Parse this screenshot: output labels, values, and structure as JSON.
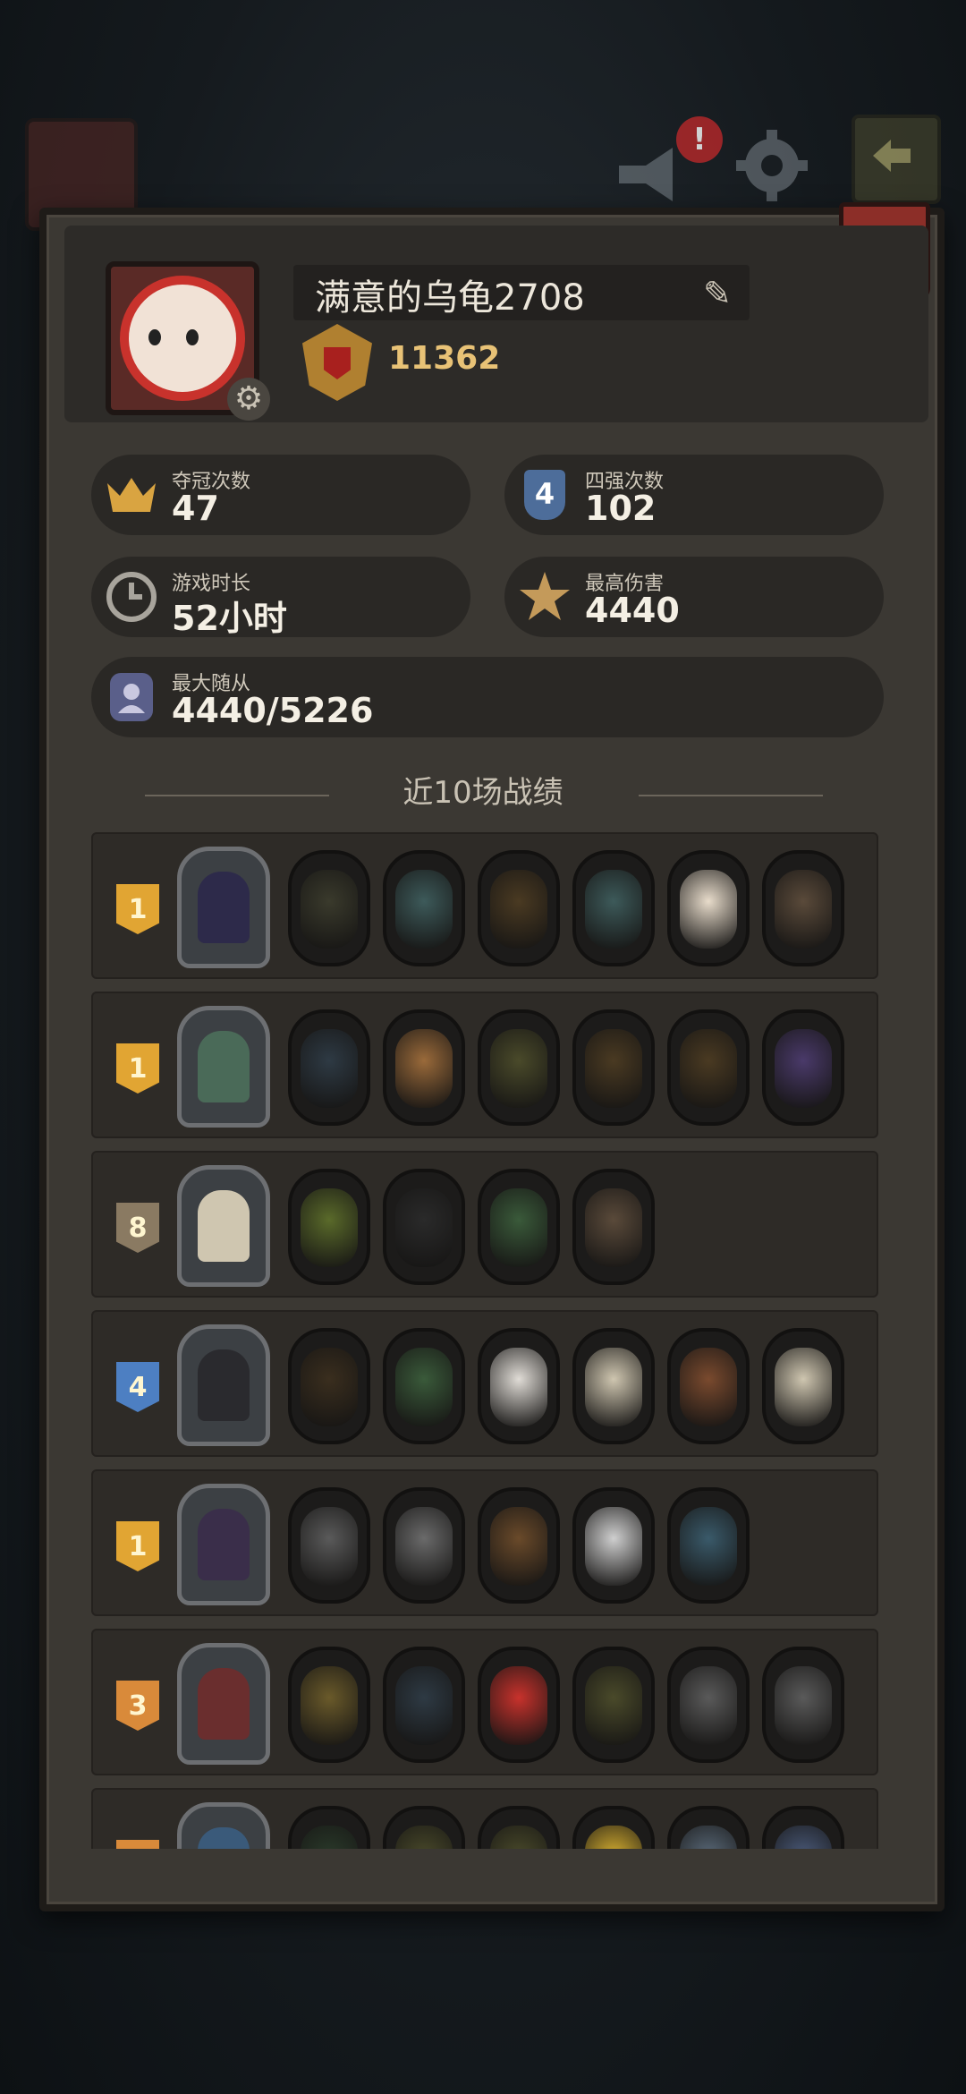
{
  "colors": {
    "gold": "#e8c276",
    "panel": "#3b3833",
    "badge_gold": "#e1a533",
    "badge_blue": "#4d7fc2",
    "badge_tan": "#8a7a62",
    "badge_orange": "#d98a3a"
  },
  "topbar": {
    "notification_count": "!"
  },
  "profile": {
    "name": "满意的乌龟2708",
    "score": "11362"
  },
  "stats": {
    "championships": {
      "label": "夺冠次数",
      "value": "47"
    },
    "top4": {
      "label": "四强次数",
      "value": "102"
    },
    "playtime": {
      "label": "游戏时长",
      "value": "52小时"
    },
    "max_damage": {
      "label": "最高伤害",
      "value": "4440"
    },
    "max_followers": {
      "label": "最大随从",
      "value": "4440/5226"
    },
    "top4_icon_text": "4"
  },
  "section": {
    "title": "近10场战绩"
  },
  "matches": [
    {
      "rank": "1",
      "badge": "gold",
      "hero_color": "#2d2a4a",
      "units": [
        "#3a3a2c",
        "#3d5a5a",
        "#4a3a22",
        "#3d5a5a",
        "#e8dccb",
        "#5a4a3a"
      ]
    },
    {
      "rank": "1",
      "badge": "gold",
      "hero_color": "#4a6a58",
      "units": [
        "#2e3a44",
        "#9a6a3a",
        "#4a4a2a",
        "#4a3a22",
        "#4a3a22",
        "#4a3a6a"
      ]
    },
    {
      "rank": "8",
      "badge": "tan",
      "hero_color": "#cfc6b0",
      "units": [
        "#5a6a2a",
        "#2a2a2a",
        "#3a5a3a",
        "#5a4a3a"
      ]
    },
    {
      "rank": "4",
      "badge": "blue",
      "hero_color": "#2a2a2e",
      "units": [
        "#3a2e1e",
        "#3a5a3a",
        "#e0dcd6",
        "#cfc6b0",
        "#7a4a2e",
        "#cfc6b0"
      ]
    },
    {
      "rank": "1",
      "badge": "gold",
      "hero_color": "#3a2e4a",
      "units": [
        "#5a5a5a",
        "#6a6a6a",
        "#6a4a2a",
        "#cfcfcf",
        "#3a5a6a"
      ]
    },
    {
      "rank": "3",
      "badge": "orange",
      "hero_color": "#6a2e2e",
      "units": [
        "#6a5a2a",
        "#2e3a44",
        "#c8322c",
        "#4a4a2a",
        "#5a5a5a",
        "#5a5a5a"
      ]
    },
    {
      "rank": "",
      "badge": "orange",
      "hero_color": "#3a5a7a",
      "units": [
        "#2a3a2a",
        "#4a4a2a",
        "#4a4a2a",
        "#d8b030",
        "#5a6a7a",
        "#4a5a7a"
      ]
    }
  ]
}
